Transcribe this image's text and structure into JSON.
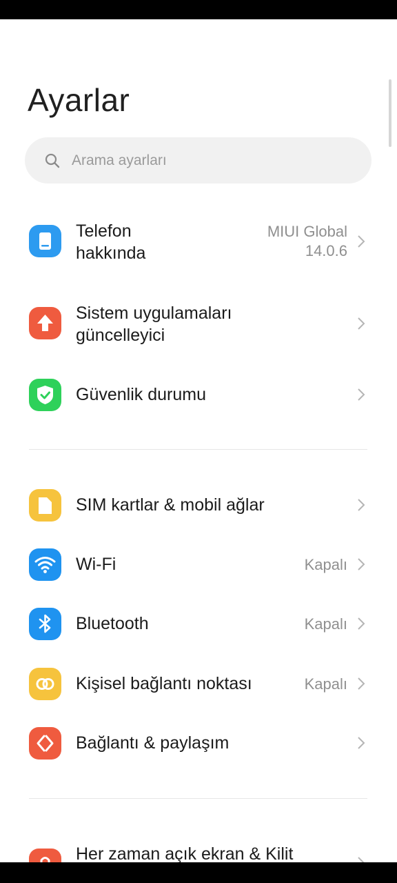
{
  "page": {
    "title": "Ayarlar"
  },
  "search": {
    "placeholder": "Arama ayarları"
  },
  "items": [
    {
      "label": "Telefon\nhakkında",
      "value": "MIUI Global\n14.0.6",
      "icon": "phone-icon",
      "color": "#2d9bf0"
    },
    {
      "label": "Sistem uygulamaları\ngüncelleyici",
      "value": "",
      "icon": "upload-arrow-icon",
      "color": "#ef5b3f"
    },
    {
      "label": "Güvenlik durumu",
      "value": "",
      "icon": "shield-check-icon",
      "color": "#2ed15a"
    },
    {
      "label": "SIM kartlar & mobil ağlar",
      "value": "",
      "icon": "sim-card-icon",
      "color": "#f6c33d"
    },
    {
      "label": "Wi-Fi",
      "value": "Kapalı",
      "icon": "wifi-icon",
      "color": "#1f93f0"
    },
    {
      "label": "Bluetooth",
      "value": "Kapalı",
      "icon": "bluetooth-icon",
      "color": "#1f93f0"
    },
    {
      "label": "Kişisel bağlantı noktası",
      "value": "Kapalı",
      "icon": "hotspot-icon",
      "color": "#f6c33d"
    },
    {
      "label": "Bağlantı & paylaşım",
      "value": "",
      "icon": "connection-sharing-icon",
      "color": "#ef5b3f"
    },
    {
      "label": "Her zaman açık ekran & Kilit",
      "value": "",
      "icon": "lock-icon",
      "color": "#ef5b3f"
    }
  ]
}
